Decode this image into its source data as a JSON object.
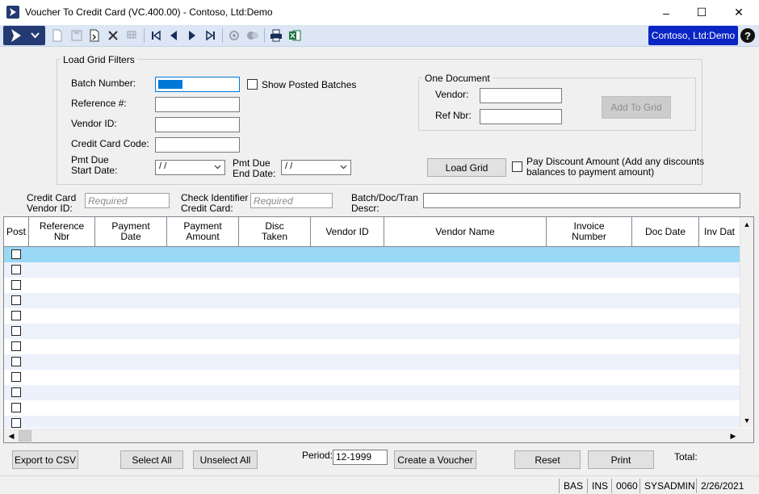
{
  "window": {
    "title": "Voucher To Credit Card (VC.400.00) - Contoso, Ltd:Demo",
    "minimize": "–",
    "maximize": "☐",
    "close": "✕"
  },
  "toolbar": {
    "company": "Contoso, Ltd:Demo",
    "help": "?",
    "icons": [
      "new-document-icon",
      "save-icon",
      "finish-icon",
      "delete-icon",
      "cancel-icon",
      "first-record-icon",
      "previous-record-icon",
      "next-record-icon",
      "last-record-icon",
      "note-icon",
      "lookup-icon",
      "print-icon",
      "excel-icon"
    ]
  },
  "filters": {
    "group_title": "Load Grid Filters",
    "batch_number_label": "Batch Number:",
    "show_posted_batches": "Show Posted Batches",
    "reference_label": "Reference #:",
    "vendor_id_label": "Vendor ID:",
    "credit_card_code_label": "Credit Card Code:",
    "pmt_due_start_line1": "Pmt Due",
    "pmt_due_start_line2": "Start Date:",
    "pmt_due_start_value": "/ /",
    "pmt_due_end_line1": "Pmt Due",
    "pmt_due_end_line2": "End Date:",
    "pmt_due_end_value": "/ /",
    "one_document": {
      "title": "One Document",
      "vendor_label": "Vendor:",
      "ref_nbr_label": "Ref Nbr:",
      "add_to_grid": "Add To Grid"
    },
    "load_grid": "Load Grid",
    "pay_discount_line1": "Pay Discount Amount (Add any discounts",
    "pay_discount_line2": "balances to payment amount)"
  },
  "entry": {
    "cc_vendor_line1": "Credit Card",
    "cc_vendor_line2": "Vendor ID:",
    "cc_vendor_placeholder": "Required",
    "check_id_line1": "Check Identifier",
    "check_id_line2": "Credit Card:",
    "check_id_placeholder": "Required",
    "descr_line1": "Batch/Doc/Tran",
    "descr_line2": "Descr:"
  },
  "grid": {
    "columns": [
      {
        "l1": "Post",
        "l2": ""
      },
      {
        "l1": "Reference",
        "l2": "Nbr"
      },
      {
        "l1": "Payment",
        "l2": "Date"
      },
      {
        "l1": "Payment",
        "l2": "Amount"
      },
      {
        "l1": "Disc",
        "l2": "Taken"
      },
      {
        "l1": "Vendor ID",
        "l2": ""
      },
      {
        "l1": "Vendor Name",
        "l2": ""
      },
      {
        "l1": "Invoice",
        "l2": "Number"
      },
      {
        "l1": "Doc Date",
        "l2": ""
      },
      {
        "l1": "Inv Dat",
        "l2": ""
      }
    ],
    "row_count": 12,
    "selected_row": 0
  },
  "bottom": {
    "export_csv": "Export to CSV",
    "select_all": "Select All",
    "unselect_all": "Unselect All",
    "period_label": "Period:",
    "period_value": "12-1999",
    "create_voucher": "Create a Voucher",
    "reset": "Reset",
    "print": "Print",
    "total_label": "Total:"
  },
  "status": {
    "mode": "BAS",
    "insert": "INS",
    "code": "0060",
    "user": "SYSADMIN",
    "date": "2/26/2021"
  },
  "colors": {
    "accent": "#243a73",
    "company_badge": "#0b24c4",
    "selected_row": "#99d9f5",
    "alt_row": "#ecf1fb"
  }
}
